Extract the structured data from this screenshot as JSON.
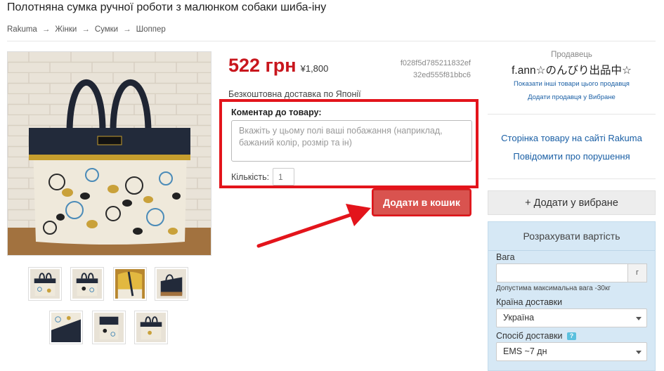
{
  "page": {
    "title": "Полотняна сумка ручної роботи з малюнком собаки шиба-іну"
  },
  "breadcrumb": [
    "Rakuma",
    "Жінки",
    "Сумки",
    "Шоппер"
  ],
  "breadcrumb_separator": "→",
  "product": {
    "price": "522 грн",
    "price_yen": "¥1,800",
    "item_id_line1": "f028f5d785211832ef",
    "item_id_line2": "32ed555f81bbc6",
    "free_shipping": "Безкоштовна доставка по Японії",
    "comment_label": "Коментар до товару:",
    "comment_placeholder": "Вкажіть у цьому полі ваші побажання (наприклад, бажаний колір, розмір та ін)",
    "quantity_label": "Кількість:",
    "quantity_value": "1",
    "add_to_cart": "Додати в кошик",
    "thumbnail_count": 7
  },
  "seller": {
    "label": "Продавець",
    "name": "f.ann☆のんびり出品中☆",
    "link_other_items": "Показати інші товари цього продавця",
    "link_add_favorite": "Додати продавця у Вибране"
  },
  "side_links": {
    "rakuma_page": "Сторінка товару на сайті Rakuma",
    "report": "Повідомити про порушення"
  },
  "favorite_button": "+ Додати у вибране",
  "calculator": {
    "title": "Розрахувати вартість",
    "weight_label": "Вага",
    "weight_value": "",
    "weight_unit": "г",
    "weight_note": "Допустима максимальна вага -30кг",
    "country_label": "Країна доставки",
    "country_value": "Україна",
    "method_label": "Спосіб доставки",
    "method_help": "?",
    "method_value": "EMS ~7 дн"
  },
  "colors": {
    "price_red": "#c8161d",
    "highlight_red": "#e3141b",
    "button_red": "#d9534f",
    "link_blue": "#1a5fa5",
    "calc_bg": "#d6e8f5"
  }
}
